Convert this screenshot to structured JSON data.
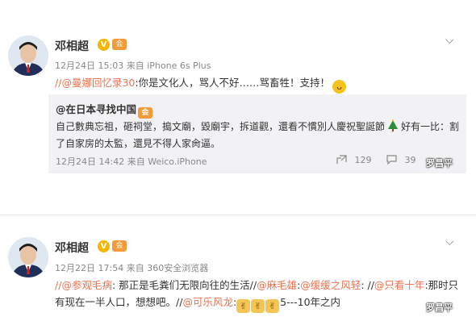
{
  "posts": [
    {
      "user": "邓相超",
      "v_badge": "V",
      "member_badge": "会",
      "time": "12月24日 15:03",
      "source_prefix": "来自",
      "source": "iPhone 6s Plus",
      "text": {
        "prefix": "//",
        "mention": "@曼娜回忆录30",
        "body": ":你是文化人，骂人不好……骂畜牲！支持！"
      },
      "repost": {
        "user": "@在日本寻找中国",
        "member_badge": "会",
        "text_a": "自己數典忘祖，砸祠堂，搗文廟，毀廟宇，拆道觀，還看不慣別人慶祝聖誕節",
        "text_b": "好有一比：割了自家房的太監，還見不得人家肏逼。",
        "time": "12月24日 14:42",
        "source_prefix": "来自",
        "source": "Weico.iPhone",
        "reposts": "129",
        "comments": "39"
      }
    },
    {
      "user": "邓相超",
      "v_badge": "V",
      "member_badge": "会",
      "time": "12月22日 17:54",
      "source_prefix": "来自",
      "source": "360安全浏览器",
      "segments": [
        {
          "t": "//",
          "m": false
        },
        {
          "t": "@参观毛病",
          "m": true
        },
        {
          "t": ": 那正是毛粪们无限向往的生活//",
          "m": false
        },
        {
          "t": "@麻毛雄",
          "m": true
        },
        {
          "t": ":",
          "m": false
        },
        {
          "t": "@缓缓之风轻",
          "m": true
        },
        {
          "t": ": //",
          "m": false
        },
        {
          "t": "@只看十年",
          "m": true
        },
        {
          "t": ":那时只有现在一半人口，想想吧。//",
          "m": false
        },
        {
          "t": "@可乐风龙",
          "m": true
        },
        {
          "t": ":",
          "m": false
        }
      ],
      "tail": "5---10年之内"
    }
  ],
  "watermark": "罗昌平"
}
